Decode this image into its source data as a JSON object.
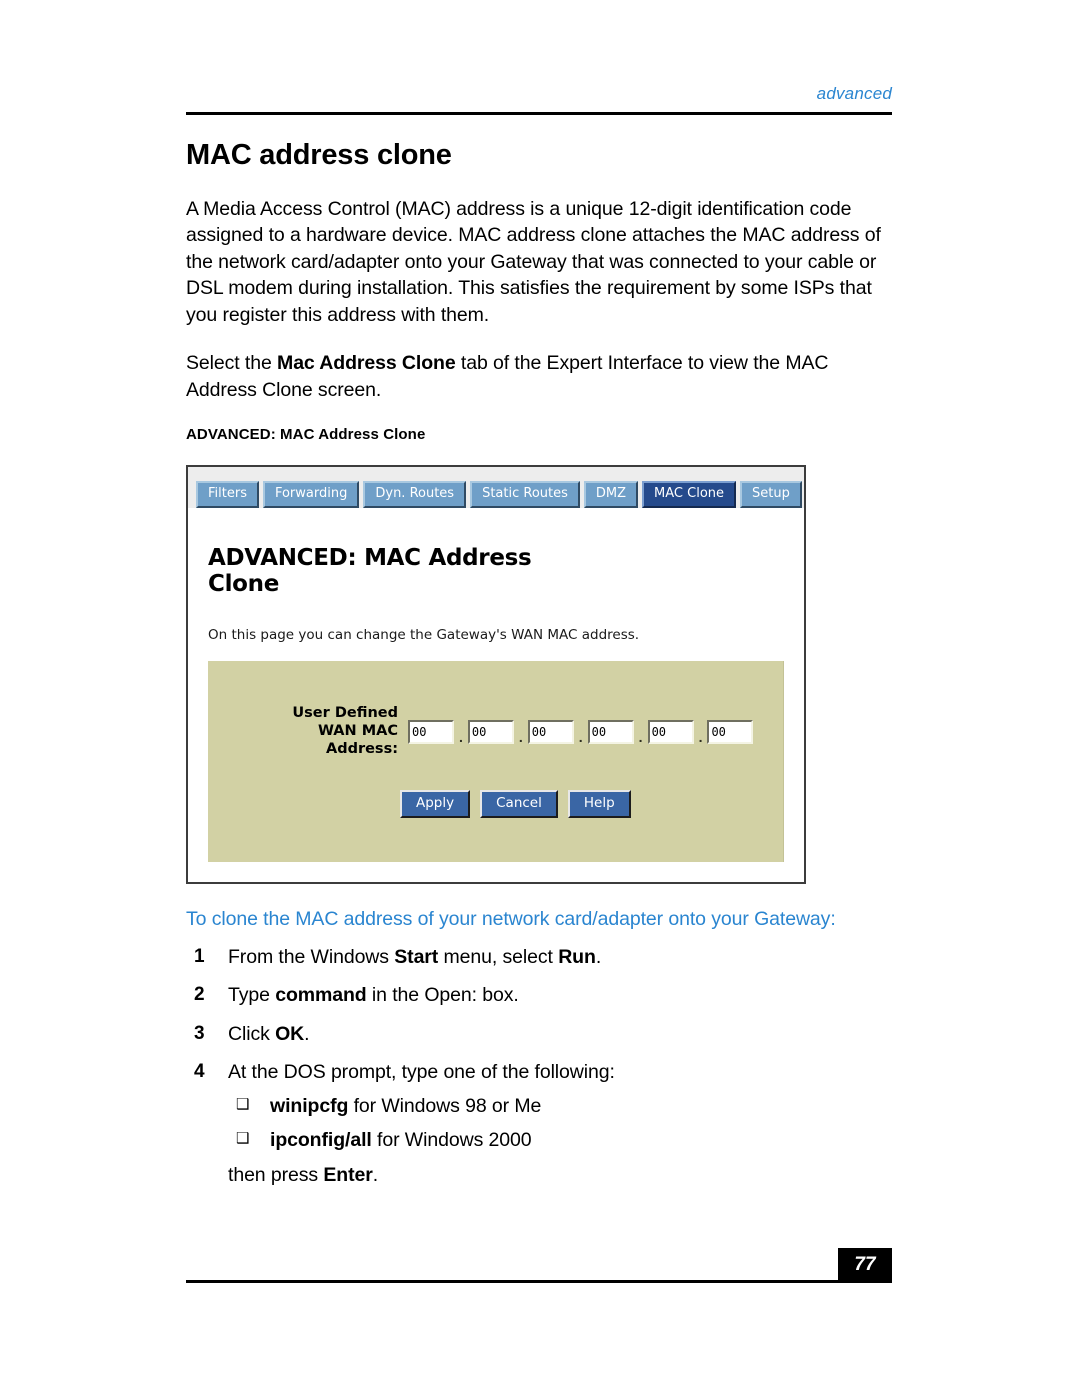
{
  "header": {
    "section_label": "advanced"
  },
  "page_title": "MAC address clone",
  "paragraphs": {
    "intro_1": "A Media Access Control (MAC) address is a unique 12-digit identification code assigned to a hardware device. MAC address clone attaches the MAC address of the network card/adapter onto your Gateway that was connected to your cable or DSL modem during installation. This satisfies the requirement by some ISPs that you register this address with them.",
    "intro_2_before": "Select the ",
    "intro_2_bold": "Mac Address Clone",
    "intro_2_after": " tab of the Expert Interface to view the MAC Address Clone screen."
  },
  "figure": {
    "caption": "ADVANCED: MAC Address Clone",
    "tabs": [
      {
        "label": "Filters",
        "active": false
      },
      {
        "label": "Forwarding",
        "active": false
      },
      {
        "label": "Dyn. Routes",
        "active": false
      },
      {
        "label": "Static Routes",
        "active": false
      },
      {
        "label": "DMZ",
        "active": false
      },
      {
        "label": "MAC Clone",
        "active": true
      },
      {
        "label": "Setup",
        "active": false
      }
    ],
    "screen_heading": "ADVANCED: MAC Address Clone",
    "screen_description": "On this page you can change the Gateway's WAN MAC address.",
    "form": {
      "field_label_line1": "User Defined",
      "field_label_line2": "WAN MAC Address:",
      "octets": [
        "00",
        "00",
        "00",
        "00",
        "00",
        "00"
      ],
      "separator": ".",
      "buttons": [
        "Apply",
        "Cancel",
        "Help"
      ]
    },
    "colors": {
      "panel_background": "#d2d1a4",
      "tab_inactive": "#6f9fc8",
      "tab_active": "#254a8c",
      "button": "#3a66a5",
      "tabbar_background": "#ededed"
    }
  },
  "procedure": {
    "lead_in": "To clone the MAC address of your network card/adapter onto your Gateway:",
    "steps": [
      {
        "number": "1",
        "before": "From the Windows ",
        "bold1": "Start",
        "middle": " menu, select ",
        "bold2": "Run",
        "after": "."
      },
      {
        "number": "2",
        "before": "Type ",
        "bold1": "command",
        "middle": " in the Open: box.",
        "bold2": "",
        "after": ""
      },
      {
        "number": "3",
        "before": "Click ",
        "bold1": "OK",
        "middle": ".",
        "bold2": "",
        "after": ""
      },
      {
        "number": "4",
        "before": "At the DOS prompt, type one of the following:",
        "bold1": "",
        "middle": "",
        "bold2": "",
        "after": ""
      }
    ],
    "sub_items": [
      {
        "bullet": "square-bullet-icon",
        "bold": "winipcfg",
        "rest": " for Windows 98 or Me"
      },
      {
        "bullet": "square-bullet-icon",
        "bold": "ipconfig/all",
        "rest": " for Windows 2000"
      }
    ],
    "tail_before": "then press ",
    "tail_bold": "Enter",
    "tail_after": "."
  },
  "footer": {
    "page_number": "77"
  },
  "theme": {
    "accent_blue": "#2a85d0",
    "rule_black": "#000000"
  }
}
